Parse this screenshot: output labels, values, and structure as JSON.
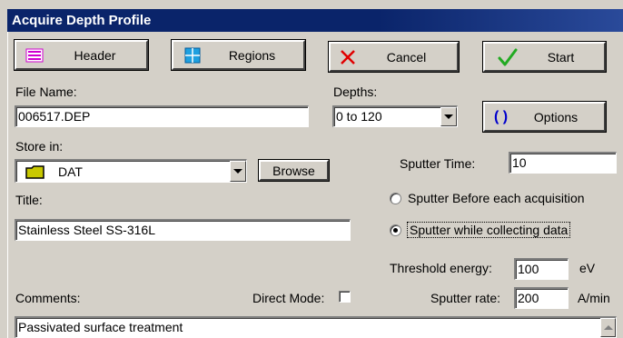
{
  "window": {
    "title": "Acquire Depth Profile"
  },
  "toolbar": {
    "header_label": "Header",
    "regions_label": "Regions",
    "cancel_label": "Cancel",
    "start_label": "Start"
  },
  "file_name": {
    "label": "File Name:",
    "value": "006517.DEP"
  },
  "depths": {
    "label": "Depths:",
    "value": "0 to 120"
  },
  "options": {
    "label": "Options"
  },
  "store_in": {
    "label": "Store in:",
    "value": "DAT",
    "browse_label": "Browse"
  },
  "sputter_time": {
    "label": "Sputter Time:",
    "value": "10"
  },
  "title_field": {
    "label": "Title:",
    "value": "Stainless Steel SS-316L"
  },
  "sputter_mode": {
    "before_label": "Sputter Before each acquisition",
    "while_label": "Sputter  while collecting data",
    "selected": "while"
  },
  "threshold": {
    "label": "Threshold energy:",
    "value": "100",
    "unit": "eV"
  },
  "sputter_rate": {
    "label": "Sputter rate:",
    "value": "200",
    "unit": "A/min"
  },
  "comments": {
    "label": "Comments:",
    "value": "Passivated surface treatment"
  },
  "direct_mode": {
    "label": "Direct Mode:",
    "checked": false
  },
  "colors": {
    "titlebar": "#0a246a",
    "face": "#d4d0c8",
    "cancel_x": "#e00000",
    "start_check": "#22aa22",
    "folder": "#c8c800"
  }
}
